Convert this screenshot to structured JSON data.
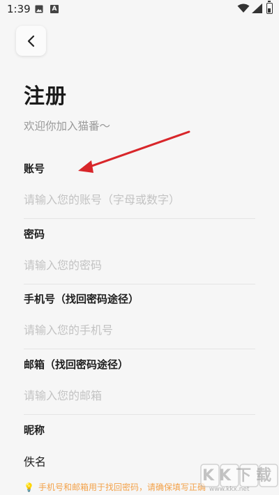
{
  "status_bar": {
    "time": "1:39",
    "icons": [
      "image-icon",
      "a-icon",
      "wifi-icon",
      "signal-icon",
      "battery-icon"
    ],
    "a_icon_letter": "A"
  },
  "header": {
    "back_icon": "chevron-left-icon",
    "title": "注册",
    "subtitle": "欢迎你加入猫番～"
  },
  "form": {
    "account": {
      "label": "账号",
      "value": "",
      "placeholder": "请输入您的账号（字母或数字）"
    },
    "password": {
      "label": "密码",
      "value": "",
      "placeholder": "请输入您的密码"
    },
    "phone": {
      "label": "手机号（找回密码途径）",
      "value": "",
      "placeholder": "请输入您的手机号"
    },
    "email": {
      "label": "邮箱（找回密码途径）",
      "value": "",
      "placeholder": "请输入您的邮箱"
    },
    "nickname": {
      "label": "昵称",
      "value": "佚名",
      "placeholder": ""
    }
  },
  "notice": {
    "icon": "lightbulb-icon",
    "text": "手机号和邮箱用于找回密码，请确保填写正确"
  },
  "watermark": {
    "logo_text": "KK下载",
    "url": "www.kkx.net"
  },
  "colors": {
    "background": "#f6f6f6",
    "title": "#1b1b1b",
    "placeholder": "#c3c3c3",
    "divider": "#e4e4e4",
    "notice": "#f3a24a",
    "arrow": "#d8262a"
  }
}
